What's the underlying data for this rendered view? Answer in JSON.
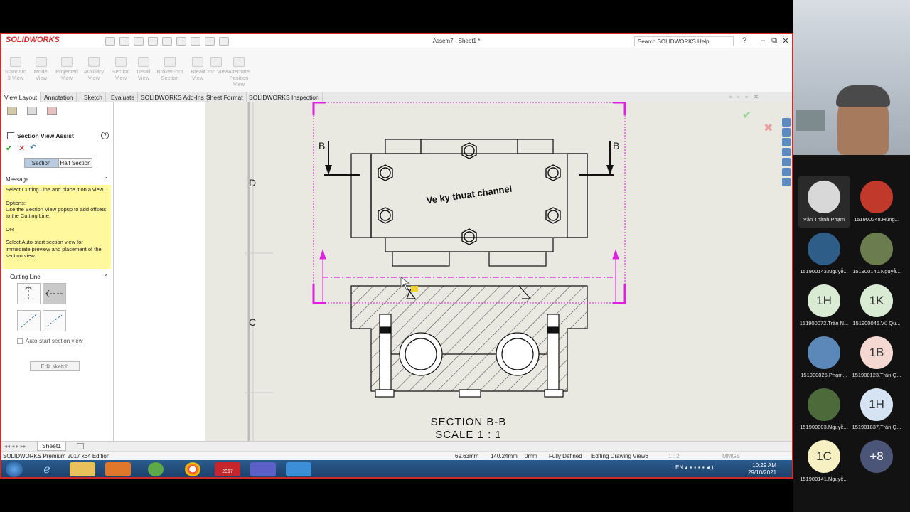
{
  "app": {
    "brand": "SOLIDWORKS",
    "title": "Assem7 - Sheet1 *",
    "search_placeholder": "Search SOLIDWORKS Help",
    "controls": [
      "?",
      "–",
      "⧉",
      "✕"
    ]
  },
  "commands": [
    {
      "label": "Standard 3 View"
    },
    {
      "label": "Model View"
    },
    {
      "label": "Projected View"
    },
    {
      "label": "Auxiliary View"
    },
    {
      "label": "Section View"
    },
    {
      "label": "Detail View"
    },
    {
      "label": "Broken-out Section"
    },
    {
      "label": "Break View"
    },
    {
      "label": "Crop View"
    },
    {
      "label": "Alternate Position View"
    }
  ],
  "tabs": [
    "View Layout",
    "Annotation",
    "Sketch",
    "Evaluate",
    "SOLIDWORKS Add-Ins",
    "Sheet Format",
    "SOLIDWORKS Inspection"
  ],
  "property_manager": {
    "title": "Section View Assist",
    "ok": "✔",
    "cancel": "✕",
    "section_btn": "Section",
    "half_section_btn": "Half Section",
    "message_title": "Message",
    "message_text": "Select Cutting Line and place it on a view.\n\nOptions:\nUse the Section View popup to add offsets to the Cutting Line.\n\nOR\n\nSelect Auto-start section view for immediate preview and placement of the section view.",
    "cutting_line_title": "Cutting Line",
    "auto_start_label": "Auto-start section view",
    "edit_sketch": "Edit sketch"
  },
  "drawing": {
    "zone_d": "D",
    "zone_c": "C",
    "label_b_left": "B",
    "label_b_right": "B",
    "watermark": "Ve ky thuat channel",
    "section_title": "SECTION B-B",
    "scale": "SCALE 1 : 1"
  },
  "sheet_tab": "Sheet1",
  "status": {
    "edition": "SOLIDWORKS Premium 2017 x64 Edition",
    "x": "69.63mm",
    "y": "140.24mm",
    "z": "0mm",
    "state": "Fully Defined",
    "editing": "Editing Drawing View6",
    "scale": "1 : 2",
    "units": "MMGS"
  },
  "taskbar": {
    "lang": "EN",
    "time": "10:29 AM",
    "date": "29/10/2021",
    "sw_year": "2017"
  },
  "meeting": {
    "participants": [
      {
        "name": "Văn Thành Phạm",
        "initials": "",
        "color": "#d8d8d8",
        "selected": true
      },
      {
        "name": "151900248.Hùng...",
        "initials": "",
        "color": "#c0392b",
        "selected": false
      },
      {
        "name": "151900143.Nguyễ...",
        "initials": "",
        "color": "#2e5d87",
        "selected": false
      },
      {
        "name": "151900140.Nguyễ...",
        "initials": "",
        "color": "#6b7d4e",
        "selected": false
      },
      {
        "name": "151900072.Trần N...",
        "initials": "1H",
        "color": "#d9ebd3",
        "selected": false
      },
      {
        "name": "151900046.Vũ Qu...",
        "initials": "1K",
        "color": "#d9ebd3",
        "selected": false
      },
      {
        "name": "151900025.Phạm...",
        "initials": "",
        "color": "#5b88b8",
        "selected": false
      },
      {
        "name": "151900123.Trần Q...",
        "initials": "1B",
        "color": "#f6d8d2",
        "selected": false
      },
      {
        "name": "151900003.Nguyễ...",
        "initials": "",
        "color": "#4d6b3a",
        "selected": false
      },
      {
        "name": "151901837.Trần Q...",
        "initials": "1H",
        "color": "#d5e3f3",
        "selected": false
      },
      {
        "name": "151900141.Nguyễ...",
        "initials": "1C",
        "color": "#f7f0c2",
        "selected": false
      },
      {
        "name": "",
        "initials": "+8",
        "color": "#4a5578",
        "selected": false
      }
    ]
  },
  "colors": {
    "accent": "#d12a2a",
    "cutting_line": "#e020e0",
    "note_bg": "#fff89c"
  }
}
